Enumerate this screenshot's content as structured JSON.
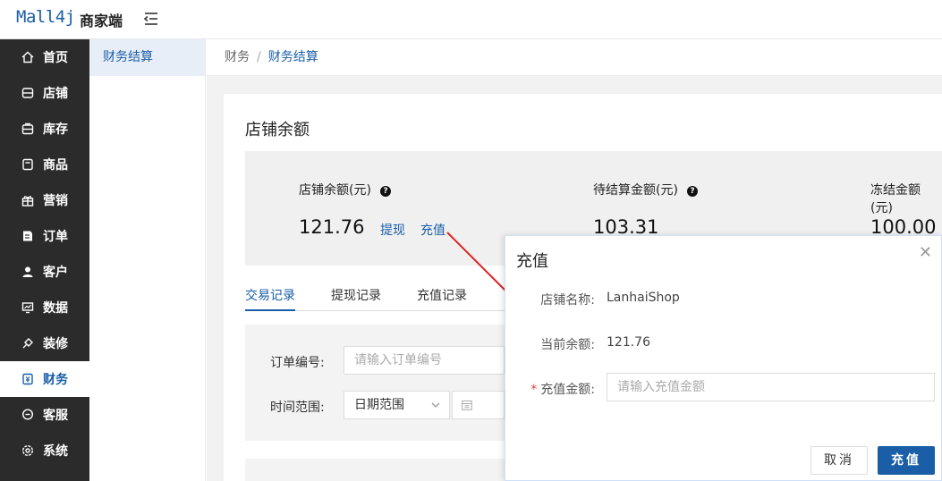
{
  "header": {
    "logo": "Mall4j",
    "subtitle": "商家端"
  },
  "sidebar": {
    "items": [
      {
        "label": "首页",
        "icon": "home-icon"
      },
      {
        "label": "店铺",
        "icon": "shop-icon"
      },
      {
        "label": "库存",
        "icon": "inventory-icon"
      },
      {
        "label": "商品",
        "icon": "product-icon"
      },
      {
        "label": "营销",
        "icon": "gift-icon"
      },
      {
        "label": "订单",
        "icon": "order-icon"
      },
      {
        "label": "客户",
        "icon": "user-icon"
      },
      {
        "label": "数据",
        "icon": "data-icon"
      },
      {
        "label": "装修",
        "icon": "decor-icon"
      },
      {
        "label": "财务",
        "icon": "finance-icon"
      },
      {
        "label": "客服",
        "icon": "chat-icon"
      },
      {
        "label": "系统",
        "icon": "settings-icon"
      }
    ],
    "active_index": 9
  },
  "subnav": {
    "item": "财务结算"
  },
  "breadcrumb": {
    "parent": "财务",
    "separator": "/",
    "current": "财务结算"
  },
  "main": {
    "section_title": "店铺余额",
    "balance": {
      "shop_label": "店铺余额(元)",
      "shop_value": "121.76",
      "withdraw": "提现",
      "recharge": "充值",
      "pending_label": "待结算金额(元)",
      "pending_value": "103.31",
      "frozen_label": "冻结金额(元)",
      "frozen_value": "100.00"
    },
    "tabs": [
      "交易记录",
      "提现记录",
      "充值记录"
    ],
    "filters": {
      "order_label": "订单编号:",
      "order_placeholder": "请输入订单编号",
      "time_label": "时间范围:",
      "time_select": "日期范围"
    }
  },
  "modal": {
    "title": "充值",
    "shop_name_label": "店铺名称:",
    "shop_name_value": "LanhaiShop",
    "balance_label": "当前余额:",
    "balance_value": "121.76",
    "amount_required": "*",
    "amount_label": "充值金额:",
    "amount_placeholder": "请输入充值金额",
    "cancel": "取消",
    "confirm": "充值"
  },
  "colors": {
    "accent": "#1a5ea8",
    "sidebar_bg": "#2b2b2b",
    "arrow": "#e02020"
  }
}
